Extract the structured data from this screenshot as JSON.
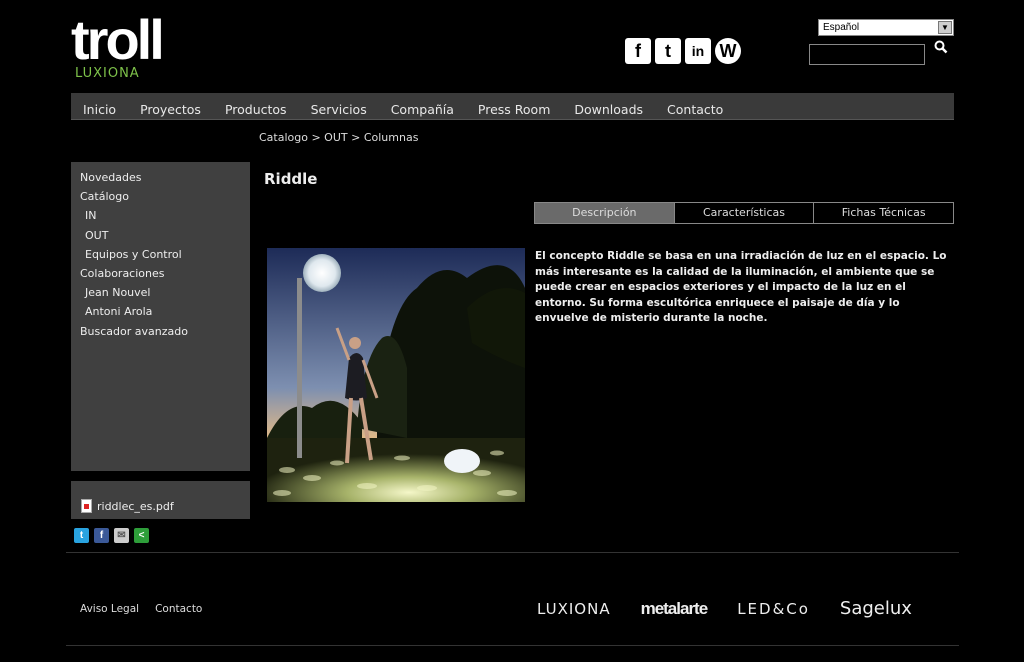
{
  "logo": {
    "main": "troll",
    "sub": "LUXIONA"
  },
  "language": {
    "selected": "Español"
  },
  "search": {
    "value": ""
  },
  "social_top": [
    {
      "icon": "facebook-icon",
      "glyph": "f"
    },
    {
      "icon": "twitter-icon",
      "glyph": "t"
    },
    {
      "icon": "linkedin-icon",
      "glyph": "in"
    },
    {
      "icon": "wordpress-icon",
      "glyph": "W"
    }
  ],
  "nav": [
    "Inicio",
    "Proyectos",
    "Productos",
    "Servicios",
    "Compañía",
    "Press Room",
    "Downloads",
    "Contacto"
  ],
  "breadcrumb": "Catalogo > OUT > Columnas",
  "sidebar": {
    "items": [
      {
        "label": "Novedades",
        "sub": false
      },
      {
        "label": "Catálogo",
        "sub": false
      },
      {
        "label": "IN",
        "sub": true
      },
      {
        "label": "OUT",
        "sub": true
      },
      {
        "label": "Equipos y Control",
        "sub": true
      },
      {
        "label": "Colaboraciones",
        "sub": false
      },
      {
        "label": "Jean Nouvel",
        "sub": true
      },
      {
        "label": "Antoni Arola",
        "sub": true
      },
      {
        "label": "Buscador avanzado",
        "sub": false
      }
    ],
    "pdf": "riddlec_es.pdf"
  },
  "share": [
    {
      "icon": "twitter-share-icon",
      "color": "#29a3e0",
      "glyph": "t"
    },
    {
      "icon": "facebook-share-icon",
      "color": "#3b5998",
      "glyph": "f"
    },
    {
      "icon": "email-share-icon",
      "color": "#cccccc",
      "glyph": "✉"
    },
    {
      "icon": "share-icon",
      "color": "#2e9e3a",
      "glyph": "<"
    }
  ],
  "product": {
    "title": "Riddle",
    "tabs": [
      {
        "label": "Descripción",
        "active": true
      },
      {
        "label": "Características",
        "active": false
      },
      {
        "label": "Fichas Técnicas",
        "active": false
      }
    ],
    "description": "El concepto Riddle se basa en una irradiación de luz en el espacio. Lo más interesante es la calidad de la iluminación, el ambiente que se puede crear en espacios exteriores y el impacto de la luz en el entorno. Su forma escultórica enriquece el paisaje de día y lo envuelve de misterio durante la noche."
  },
  "footer": {
    "links": [
      "Aviso Legal",
      "Contacto"
    ],
    "brands": [
      "LUXIONA",
      "metalarte",
      "LED&Co",
      "Sagelux"
    ]
  },
  "colors": {
    "background": "#000000",
    "panel": "#404040",
    "nav": "#3a3a3a",
    "accent_green": "#7ec24a"
  }
}
